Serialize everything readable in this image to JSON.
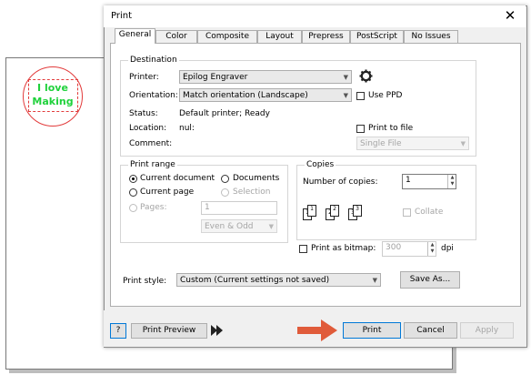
{
  "background_document": {
    "logo_line1": "I love",
    "logo_line2": "Making",
    "logo_color": "#1fd13b",
    "circle_color": "#e23b3b"
  },
  "dialog": {
    "title": "Print",
    "close_icon": "close-icon",
    "tabs": [
      {
        "label": "General",
        "active": true
      },
      {
        "label": "Color",
        "active": false
      },
      {
        "label": "Composite",
        "active": false
      },
      {
        "label": "Layout",
        "active": false
      },
      {
        "label": "Prepress",
        "active": false
      },
      {
        "label": "PostScript",
        "active": false
      },
      {
        "label": "No Issues",
        "active": false
      }
    ]
  },
  "destination": {
    "group_label": "Destination",
    "printer_label": "Printer:",
    "printer_value": "Epilog Engraver",
    "printer_settings_icon": "gear-icon",
    "orientation_label": "Orientation:",
    "orientation_value": "Match orientation (Landscape)",
    "use_ppd_label": "Use PPD",
    "status_label": "Status:",
    "status_value": "Default printer; Ready",
    "location_label": "Location:",
    "location_value": "nul:",
    "print_to_file_label": "Print to file",
    "comment_label": "Comment:",
    "file_mode_value": "Single File"
  },
  "print_range": {
    "group_label": "Print range",
    "current_document": "Current document",
    "documents": "Documents",
    "current_page": "Current page",
    "selection": "Selection",
    "pages": "Pages:",
    "pages_value": "1",
    "even_odd_value": "Even & Odd"
  },
  "copies": {
    "group_label": "Copies",
    "number_label": "Number of copies:",
    "number_value": "1",
    "collate_label": "Collate",
    "page_numbers": [
      "1",
      "1",
      "2",
      "2",
      "3",
      "3"
    ]
  },
  "bitmap": {
    "label": "Print as bitmap:",
    "value": "300",
    "unit": "dpi"
  },
  "print_style": {
    "label": "Print style:",
    "value": "Custom (Current settings not saved)",
    "save_as": "Save As..."
  },
  "footer": {
    "help": "?",
    "print_preview": "Print Preview",
    "expand_icon": "double-arrow-right-icon",
    "pointer_icon": "arrow-right-icon",
    "pointer_color": "#e05b3a",
    "print": "Print",
    "cancel": "Cancel",
    "apply": "Apply"
  }
}
